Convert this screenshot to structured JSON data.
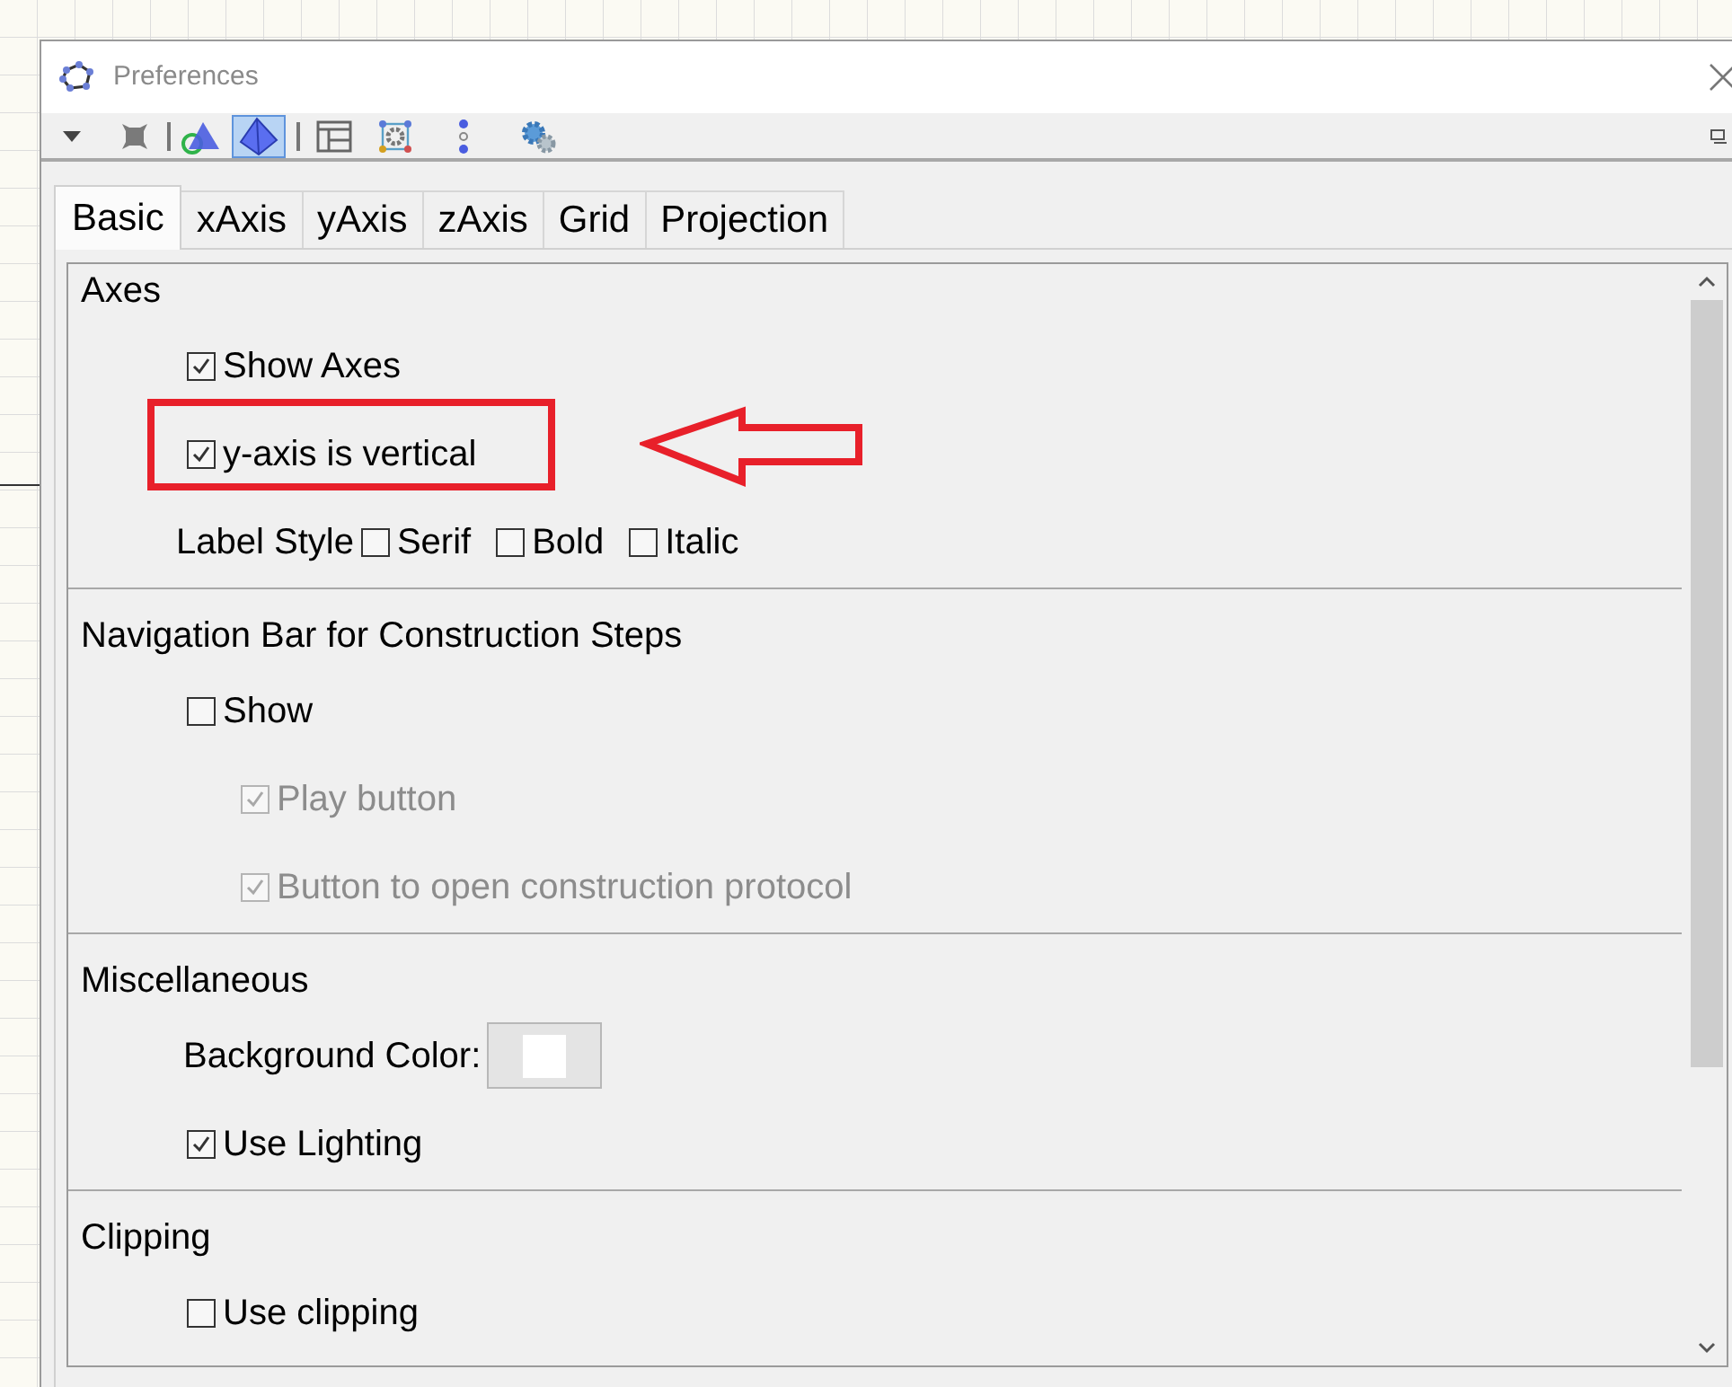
{
  "window": {
    "title": "Preferences"
  },
  "toolbar": [
    {
      "kind": "caret",
      "selected": false
    },
    {
      "kind": "cube",
      "selected": false
    },
    {
      "kind": "separator"
    },
    {
      "kind": "plane",
      "selected": false
    },
    {
      "kind": "pyramid",
      "selected": true
    },
    {
      "kind": "separator"
    },
    {
      "kind": "layout",
      "selected": false
    },
    {
      "kind": "gearbox",
      "selected": false
    },
    {
      "kind": "dots",
      "selected": false
    },
    {
      "kind": "gears",
      "selected": false
    }
  ],
  "tabs": [
    {
      "label": "Basic",
      "selected": true
    },
    {
      "label": "xAxis",
      "selected": false
    },
    {
      "label": "yAxis",
      "selected": false
    },
    {
      "label": "zAxis",
      "selected": false
    },
    {
      "label": "Grid",
      "selected": false
    },
    {
      "label": "Projection",
      "selected": false
    }
  ],
  "sections": [
    {
      "title": "Axes",
      "rows": [
        {
          "kind": "checkbox",
          "label": "Show Axes",
          "checked": true,
          "disabled": false
        },
        {
          "kind": "checkbox",
          "label": "y-axis is vertical",
          "checked": true,
          "disabled": false
        },
        {
          "kind": "options",
          "label": "Label Style",
          "options": [
            {
              "label": "Serif",
              "checked": false
            },
            {
              "label": "Bold",
              "checked": false
            },
            {
              "label": "Italic",
              "checked": false
            }
          ]
        }
      ]
    },
    {
      "title": "Navigation Bar for Construction Steps",
      "rows": [
        {
          "kind": "checkbox",
          "label": "Show",
          "checked": false,
          "disabled": false,
          "children": [
            {
              "kind": "checkbox",
              "label": "Play button",
              "checked": true,
              "disabled": true
            },
            {
              "kind": "checkbox",
              "label": "Button to open construction protocol",
              "checked": true,
              "disabled": true
            }
          ]
        }
      ]
    },
    {
      "title": "Miscellaneous",
      "rows": [
        {
          "kind": "color",
          "label": "Background Color:",
          "color": "#ffffff"
        },
        {
          "kind": "checkbox",
          "label": "Use Lighting",
          "checked": true,
          "disabled": false
        }
      ]
    },
    {
      "title": "Clipping",
      "rows": [
        {
          "kind": "checkbox",
          "label": "Use clipping",
          "checked": false,
          "disabled": false
        }
      ]
    }
  ]
}
